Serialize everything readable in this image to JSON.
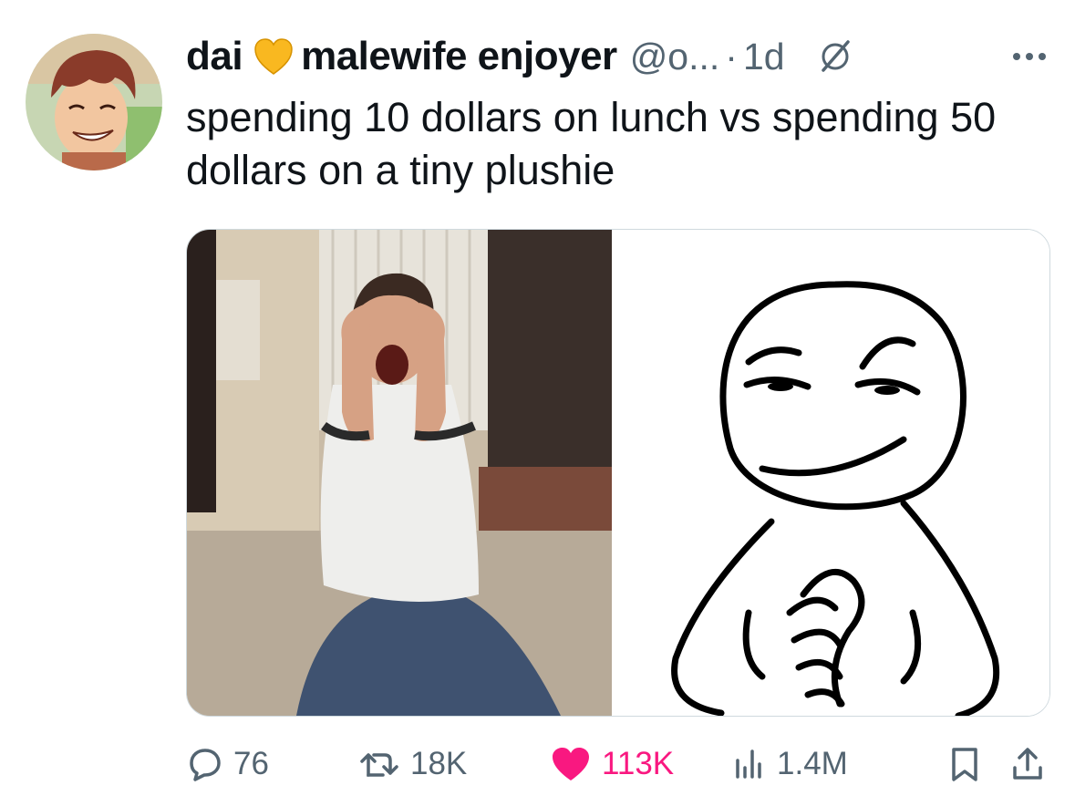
{
  "tweet": {
    "author_name": "dai",
    "author_emoji": "yellow-heart",
    "author_name_suffix": "malewife enjoyer",
    "handle": "@o...",
    "separator": "·",
    "time": "1d",
    "text": "spending 10 dollars on lunch vs spending 50 dollars on a tiny plushie"
  },
  "media": {
    "left_image": "crying-person-photo",
    "right_image": "smug-cartoon-face-drawing"
  },
  "actions": {
    "replies": "76",
    "reposts": "18K",
    "likes": "113K",
    "views": "1.4M"
  },
  "colors": {
    "text": "#0f1419",
    "muted": "#536471",
    "like": "#f91880",
    "border": "#cfd9de",
    "heart_emoji": "#f9b820"
  },
  "icons": [
    "yellow-heart-emoji",
    "grok-icon",
    "more-icon",
    "reply-icon",
    "repost-icon",
    "like-heart-icon",
    "views-icon",
    "bookmark-icon",
    "share-icon"
  ]
}
